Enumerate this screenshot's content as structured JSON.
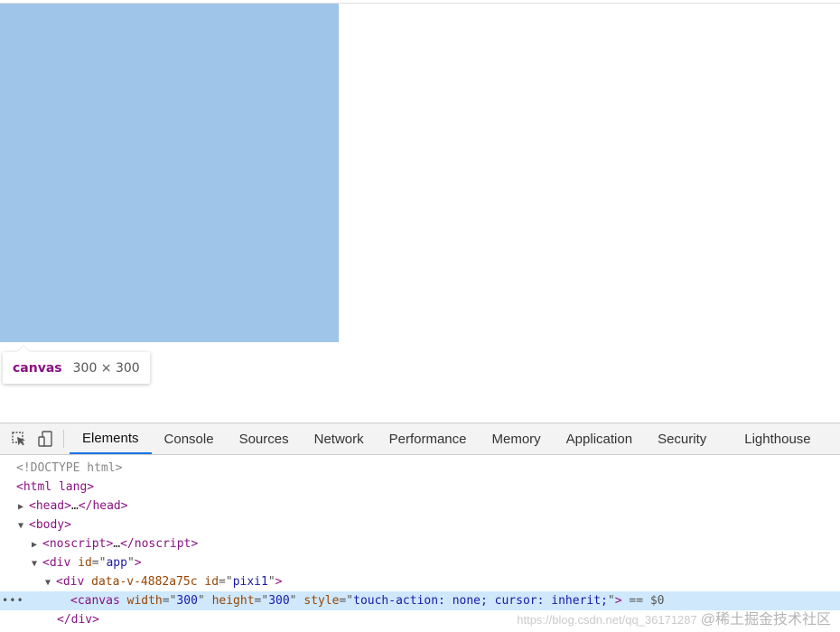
{
  "tooltip": {
    "tag": "canvas",
    "dims": "300 × 300"
  },
  "devtools": {
    "tabs": [
      "Elements",
      "Console",
      "Sources",
      "Network",
      "Performance",
      "Memory",
      "Application",
      "Security",
      "Lighthouse"
    ],
    "active_tab": "Elements"
  },
  "dom": {
    "doctype": "<!DOCTYPE html>",
    "html_open": "<html lang>",
    "head": {
      "open": "<head>",
      "ellipsis": "…",
      "close": "</head>"
    },
    "body_open": "<body>",
    "noscript": {
      "open": "<noscript>",
      "ellipsis": "…",
      "close": "</noscript>"
    },
    "div_app": {
      "tag": "div",
      "attr": "id",
      "value": "app"
    },
    "div_pixi": {
      "tag": "div",
      "attr1": "data-v-4882a75c",
      "attr2": "id",
      "value2": "pixi1"
    },
    "canvas": {
      "tag": "canvas",
      "width_attr": "width",
      "width_val": "300",
      "height_attr": "height",
      "height_val": "300",
      "style_attr": "style",
      "style_val": "touch-action: none; cursor: inherit;",
      "suffix": "== $0"
    },
    "div_close": "</div>",
    "dots": "•••"
  },
  "watermark": {
    "url": "https://blog.csdn.net/qq_36171287",
    "text": "@稀土掘金技术社区"
  }
}
